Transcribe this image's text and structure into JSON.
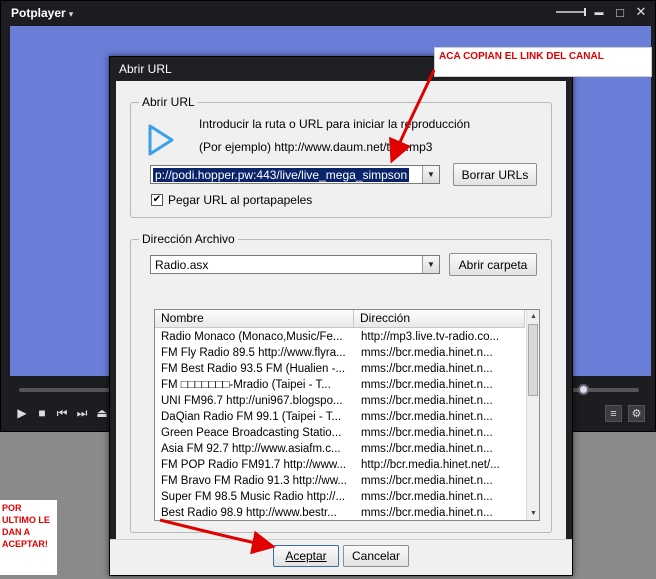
{
  "player": {
    "title": "Potplayer",
    "minimize": "▬",
    "maximize": "□",
    "close": "✕"
  },
  "dialog": {
    "title": "Abrir URL",
    "url_group": {
      "legend": "Abrir URL",
      "instruction": "Introducir la ruta o URL para iniciar la reproducción",
      "example": "(Por ejemplo) http://www.daum.net/test.mp3",
      "url_value": "p://podi.hopper.pw:443/live/live_mega_simpson",
      "clear_button": "Borrar URLs",
      "paste_checkbox_label": "Pegar URL al portapapeles",
      "paste_checked": true
    },
    "address_group": {
      "legend": "Dirección Archivo",
      "file_value": "Radio.asx",
      "open_folder_button": "Abrir carpeta",
      "columns": [
        "Nombre",
        "Dirección"
      ],
      "rows": [
        [
          "Radio Monaco (Monaco,Music/Fe...",
          "http://mp3.live.tv-radio.co..."
        ],
        [
          "FM Fly Radio 89.5 http://www.flyra...",
          "mms://bcr.media.hinet.n..."
        ],
        [
          "FM Best Radio 93.5 FM (Hualien -...",
          "mms://bcr.media.hinet.n..."
        ],
        [
          "FM □□□□□□□-Mradio (Taipei - T...",
          "mms://bcr.media.hinet.n..."
        ],
        [
          "UNI FM96.7 http://uni967.blogspo...",
          "mms://bcr.media.hinet.n..."
        ],
        [
          "DaQian Radio FM 99.1 (Taipei - T...",
          "mms://bcr.media.hinet.n..."
        ],
        [
          "Green Peace Broadcasting Statio...",
          "mms://bcr.media.hinet.n..."
        ],
        [
          "Asia FM 92.7 http://www.asiafm.c...",
          "mms://bcr.media.hinet.n..."
        ],
        [
          "FM POP Radio FM91.7 http://www...",
          "http://bcr.media.hinet.net/..."
        ],
        [
          "FM Bravo FM Radio 91.3 http://ww...",
          "mms://bcr.media.hinet.n..."
        ],
        [
          "Super FM 98.5 Music Radio http://...",
          "mms://bcr.media.hinet.n..."
        ],
        [
          "Best Radio 98.9 http://www.bestr...",
          "mms://bcr.media.hinet.n..."
        ]
      ]
    },
    "accept_button": "Aceptar",
    "cancel_button": "Cancelar"
  },
  "annotations": {
    "top_note": "ACA COPIAN EL LINK DEL CANAL",
    "bottom_note": "POR ULTIMO LE DAN A ACEPTAR!"
  },
  "colors": {
    "video_area": "#6a7ed8",
    "annotation_red": "#e00000",
    "url_selection": "#0a246a"
  }
}
